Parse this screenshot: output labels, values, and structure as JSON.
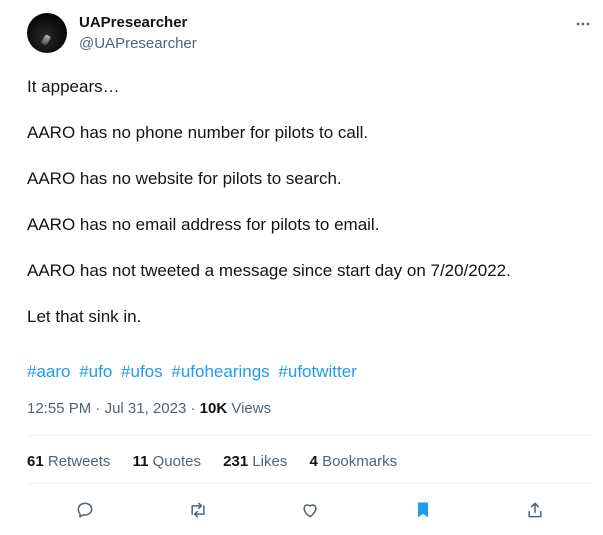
{
  "author": {
    "name": "UAPresearcher",
    "handle": "@UAPresearcher"
  },
  "tweet": {
    "lines": [
      "It appears…",
      "",
      "AARO has no phone number for pilots to call.",
      "",
      "AARO has no website for pilots to search.",
      "",
      "AARO has no email address for pilots to email.",
      "",
      "AARO has not tweeted a message since start day on 7/20/2022.",
      "",
      "Let that sink in."
    ],
    "hashtags": [
      "#aaro",
      "#ufo",
      "#ufos",
      "#ufohearings",
      "#ufotwitter"
    ]
  },
  "meta": {
    "time": "12:55 PM",
    "separator": "·",
    "date": "Jul 31, 2023",
    "views_count": "10K",
    "views_label": "Views"
  },
  "stats": {
    "retweets_count": "61",
    "retweets_label": "Retweets",
    "quotes_count": "11",
    "quotes_label": "Quotes",
    "likes_count": "231",
    "likes_label": "Likes",
    "bookmarks_count": "4",
    "bookmarks_label": "Bookmarks"
  },
  "colors": {
    "link": "#1d9bf0",
    "secondary_text": "#536471",
    "bookmark_active": "#1d9bf0"
  },
  "icons": {
    "more": "more-icon",
    "reply": "reply-icon",
    "retweet": "retweet-icon",
    "like": "like-icon",
    "bookmark": "bookmark-icon",
    "share": "share-icon"
  }
}
